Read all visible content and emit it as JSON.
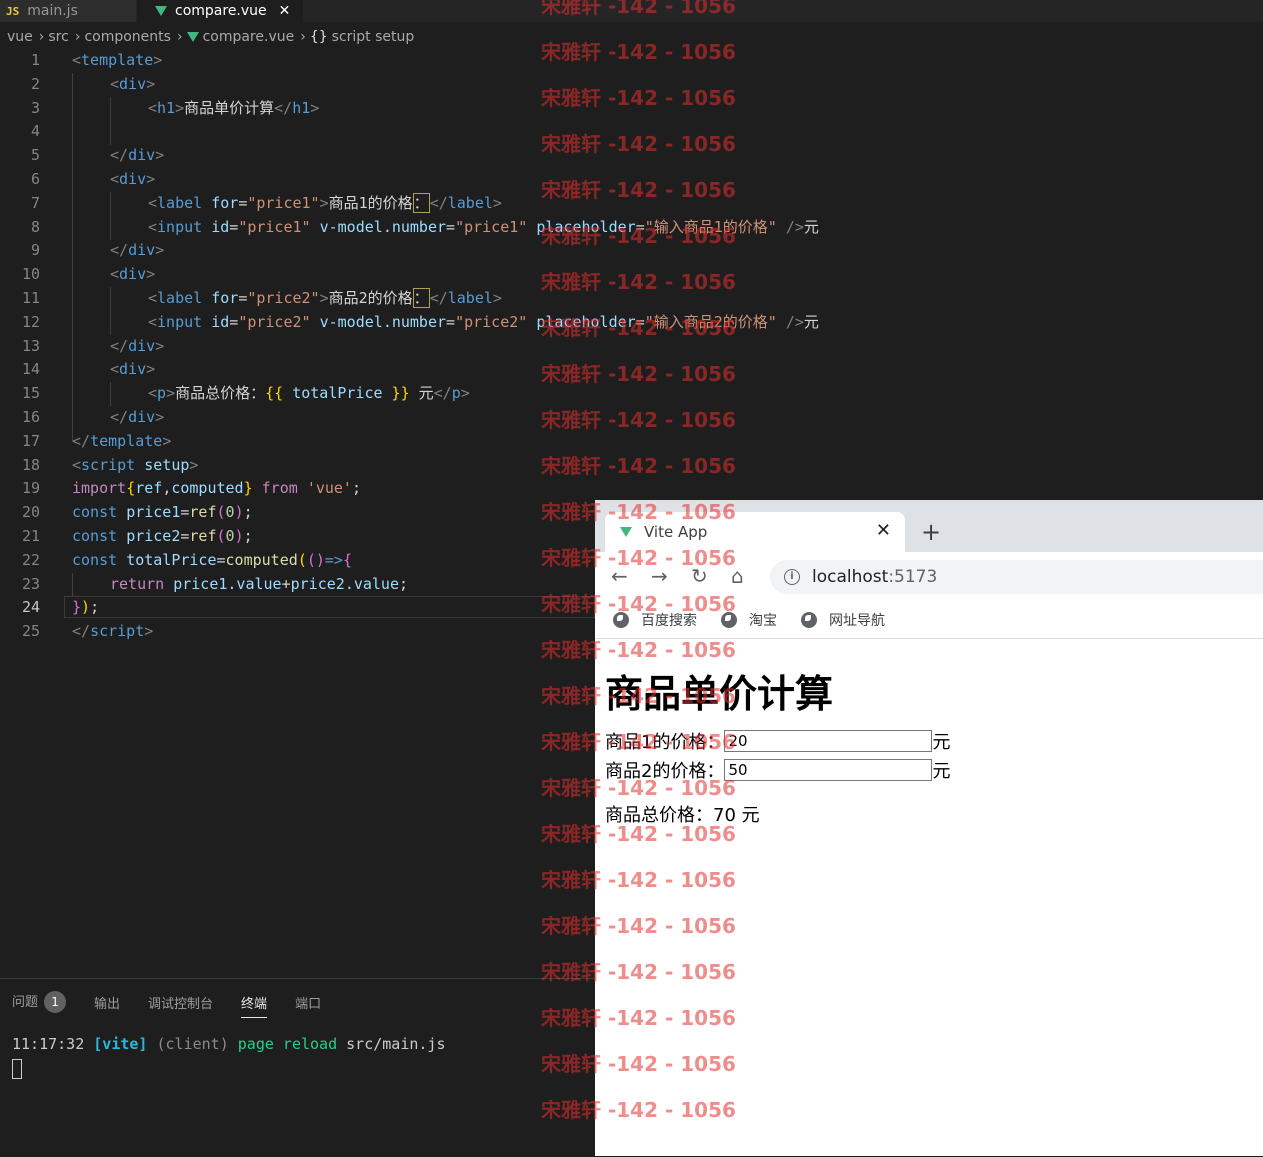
{
  "editor": {
    "tabs": [
      {
        "label": "main.js",
        "icon": "js-icon"
      },
      {
        "label": "compare.vue",
        "icon": "vue-icon",
        "active": true
      }
    ],
    "breadcrumb": [
      "vue",
      "src",
      "components",
      "compare.vue",
      "script setup"
    ],
    "active_line": "24",
    "lines": {
      "l1": [
        "1",
        "<",
        "template",
        ">"
      ],
      "l2": [
        "2",
        "<",
        "div",
        ">"
      ],
      "l3": [
        "3",
        "<",
        "h1",
        ">",
        "商品单价计算",
        "</",
        "h1",
        ">"
      ],
      "l4": [
        "4"
      ],
      "l5": [
        "5",
        "</",
        "div",
        ">"
      ],
      "l6": [
        "6",
        "<",
        "div",
        ">"
      ],
      "l7": [
        "7",
        "<",
        "label",
        "for",
        "=",
        "\"price1\"",
        ">",
        "商品1的价格",
        "：",
        "</",
        "label",
        ">"
      ],
      "l8": [
        "8",
        "<",
        "input",
        "id",
        "=",
        "\"price1\"",
        "v-model",
        ".number",
        "=",
        "\"price1\"",
        "placeholder",
        "=",
        "\"输入商品1的价格\"",
        "/>",
        "元"
      ],
      "l9": [
        "9",
        "</",
        "div",
        ">"
      ],
      "l10": [
        "10",
        "<",
        "div",
        ">"
      ],
      "l11": [
        "11",
        "<",
        "label",
        "for",
        "=",
        "\"price2\"",
        ">",
        "商品2的价格",
        "：",
        "</",
        "label",
        ">"
      ],
      "l12": [
        "12",
        "<",
        "input",
        "id",
        "=",
        "\"price2\"",
        "v-model",
        ".number",
        "=",
        "\"price2\"",
        "placeholder",
        "=",
        "\"输入商品2的价格\"",
        "/>",
        "元"
      ],
      "l13": [
        "13",
        "</",
        "div",
        ">"
      ],
      "l14": [
        "14",
        "<",
        "div",
        ">"
      ],
      "l15": [
        "15",
        "<",
        "p",
        ">",
        "商品总价格：",
        "{{",
        "totalPrice",
        "}}",
        "元",
        "</",
        "p",
        ">"
      ],
      "l16": [
        "16",
        "</",
        "div",
        ">"
      ],
      "l17": [
        "17",
        "</",
        "template",
        ">"
      ],
      "l18": [
        "18",
        "<",
        "script",
        "setup",
        ">"
      ],
      "l19": [
        "19",
        "import",
        "{",
        "ref",
        ",",
        "computed",
        "}",
        "from",
        "'vue'",
        ";"
      ],
      "l20": [
        "20",
        "const",
        "price1",
        "=",
        "ref",
        "(",
        "0",
        ")",
        ";"
      ],
      "l21": [
        "21",
        "const",
        "price2",
        "=",
        "ref",
        "(",
        "0",
        ")",
        ";"
      ],
      "l22": [
        "22",
        "const",
        "totalPrice",
        "=",
        "computed",
        "(",
        "()",
        "=>",
        "{"
      ],
      "l23": [
        "23",
        "return",
        "price1",
        ".value",
        "+",
        "price2",
        ".value",
        ";"
      ],
      "l24": [
        "24",
        "}",
        ")",
        ";"
      ],
      "l25": [
        "25",
        "</",
        "script",
        ">"
      ]
    }
  },
  "panel": {
    "tabs": [
      "问题",
      "输出",
      "调试控制台",
      "终端",
      "端口"
    ],
    "problems_count": "1",
    "active_tab": "终端",
    "terminal_line": {
      "time": "11:17:32",
      "tag": "[vite]",
      "client": "(client)",
      "msg": "page reload",
      "file": "src/main.js"
    }
  },
  "browser": {
    "tab_title": "Vite App",
    "new_tab": "+",
    "url_host": "localhost",
    "url_port": ":5173",
    "bookmarks": [
      "百度搜索",
      "淘宝",
      "网址导航"
    ],
    "page": {
      "heading": "商品单价计算",
      "label1": "商品1的价格：",
      "value1": "20",
      "placeholder1": "输入商品1的价格",
      "label2": "商品2的价格：",
      "value2": "50",
      "placeholder2": "输入商品2的价格",
      "unit": "元",
      "total_label": "商品总价格：",
      "total_value": "70",
      "total_unit": "元"
    }
  },
  "watermark": "宋雅轩 -142 - 1056",
  "colors": {
    "editor_bg": "#1e1e1e",
    "keyword": "#569cd6",
    "string": "#ce9178",
    "attribute": "#9cdcfe",
    "function": "#dcdcaa",
    "vue_green": "#41b883",
    "watermark_red": "#e12d2d"
  }
}
